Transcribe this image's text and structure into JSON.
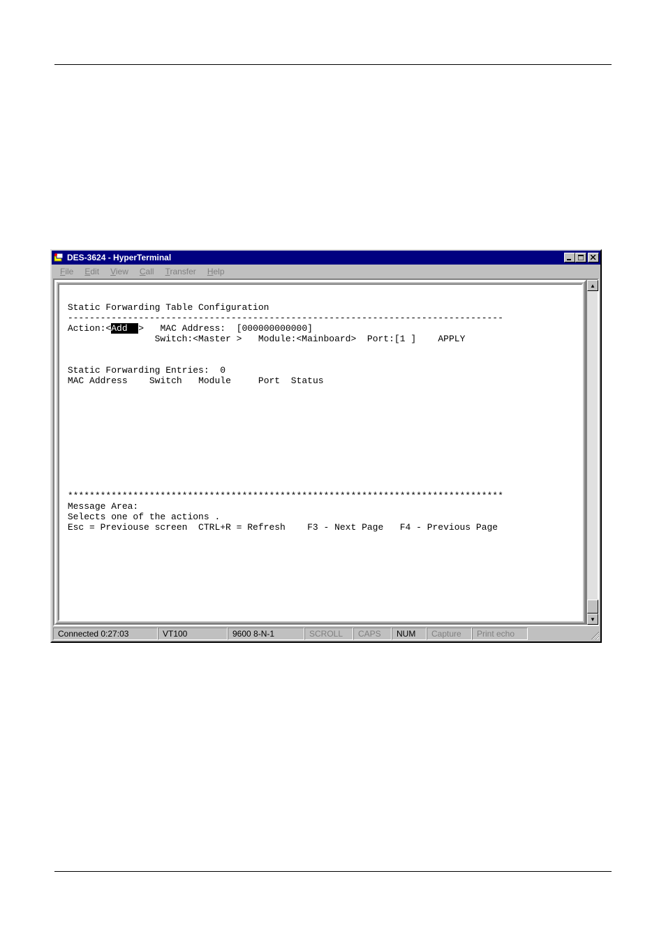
{
  "window": {
    "title": "DES-3624 - HyperTerminal"
  },
  "menu": {
    "file": "File",
    "edit": "Edit",
    "view": "View",
    "call": "Call",
    "transfer": "Transfer",
    "help": "Help"
  },
  "terminal": {
    "heading": "Static Forwarding Table Configuration",
    "divider": "--------------------------------------------------------------------------------",
    "action_label": "Action:",
    "action_open": "<",
    "action_value": "Add  ",
    "action_close": ">",
    "mac_label": "MAC Address:",
    "mac_value": "[000000000000]",
    "switch_label": "Switch:",
    "switch_value": "<Master >",
    "module_label": "Module:",
    "module_value": "<Mainboard>",
    "port_label": "Port:",
    "port_value": "[1 ]",
    "apply": "APPLY",
    "entries_label": "Static Forwarding Entries:",
    "entries_count": "0",
    "col_mac": "MAC Address",
    "col_switch": "Switch",
    "col_module": "Module",
    "col_port": "Port",
    "col_status": "Status",
    "asterisks": "********************************************************************************",
    "message_area_label": "Message Area:",
    "message_text": "Selects one of the actions .",
    "help_line": "Esc = Previouse screen  CTRL+R = Refresh    F3 - Next Page   F4 - Previous Page"
  },
  "status": {
    "connected": "Connected 0:27:03",
    "emulation": "VT100",
    "settings": "9600 8-N-1",
    "scroll": "SCROLL",
    "caps": "CAPS",
    "num": "NUM",
    "capture": "Capture",
    "print_echo": "Print echo"
  }
}
